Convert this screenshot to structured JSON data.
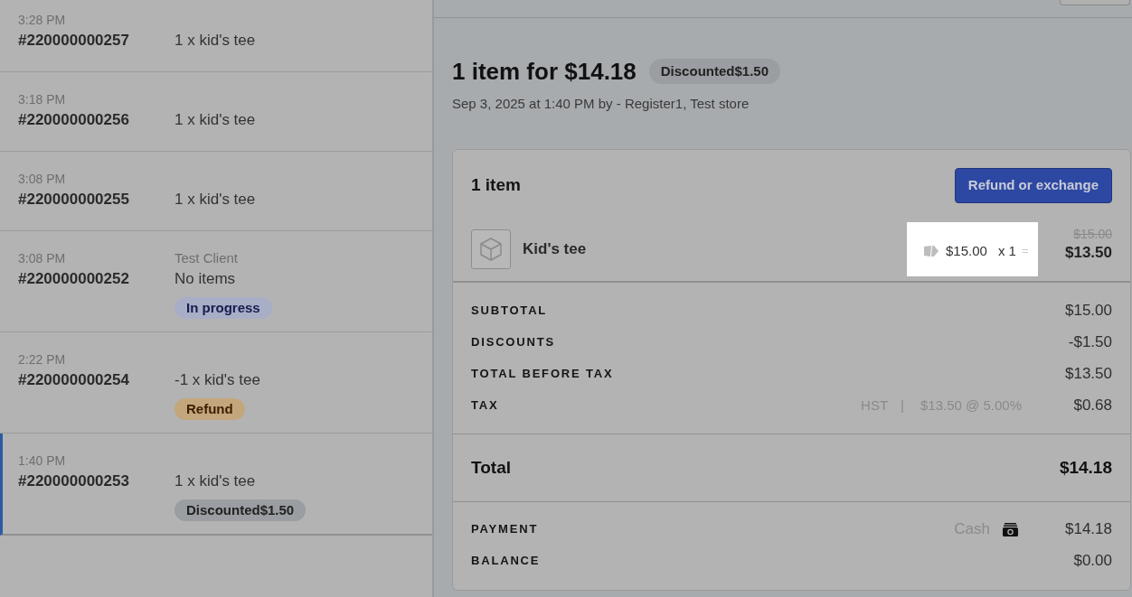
{
  "orders": [
    {
      "time": "3:28 PM",
      "number": "#220000000257",
      "description": "1 x kid's tee",
      "selected": false
    },
    {
      "time": "3:18 PM",
      "number": "#220000000256",
      "description": "1 x kid's tee",
      "selected": false
    },
    {
      "time": "3:08 PM",
      "number": "#220000000255",
      "description": "1 x kid's tee",
      "selected": false
    },
    {
      "time": "3:08 PM",
      "number": "#220000000252",
      "client": "Test Client",
      "description": "No items",
      "badge": {
        "label": "In progress",
        "kind": "in_progress"
      },
      "selected": false
    },
    {
      "time": "2:22 PM",
      "number": "#220000000254",
      "description": "-1 x kid's tee",
      "badge": {
        "label": "Refund",
        "kind": "refund"
      },
      "selected": false
    },
    {
      "time": "1:40 PM",
      "number": "#220000000253",
      "description": "1 x kid's tee",
      "badge": {
        "label": "Discounted$1.50",
        "kind": "discount"
      },
      "selected": true
    }
  ],
  "sale": {
    "title": "1 item for $14.18",
    "badge": {
      "label": "Discounted$1.50",
      "kind": "discount"
    },
    "subtitle": "Sep 3, 2025 at 1:40 PM by - Register1, Test store",
    "items_heading": "1 item",
    "action": "Refund or exchange",
    "items": [
      {
        "name": "Kid's tee",
        "unit_price": "$15.00",
        "quantity": "x 1",
        "equals": "=",
        "original_price": "$15.00",
        "price": "$13.50",
        "highlighted": true
      }
    ],
    "summary": [
      {
        "label": "SUBTOTAL",
        "value": "$15.00"
      },
      {
        "label": "DISCOUNTS",
        "value": "-$1.50"
      },
      {
        "label": "TOTAL BEFORE TAX",
        "value": "$13.50"
      },
      {
        "label": "TAX",
        "tax_name": "HST",
        "separator": "|",
        "tax_detail": "$13.50 @ 5.00%",
        "value": "$0.68"
      }
    ],
    "total": {
      "label": "Total",
      "value": "$14.18"
    },
    "payments": [
      {
        "label": "PAYMENT",
        "method": "Cash",
        "value": "$14.18"
      },
      {
        "label": "BALANCE",
        "value": "$0.00"
      }
    ]
  }
}
